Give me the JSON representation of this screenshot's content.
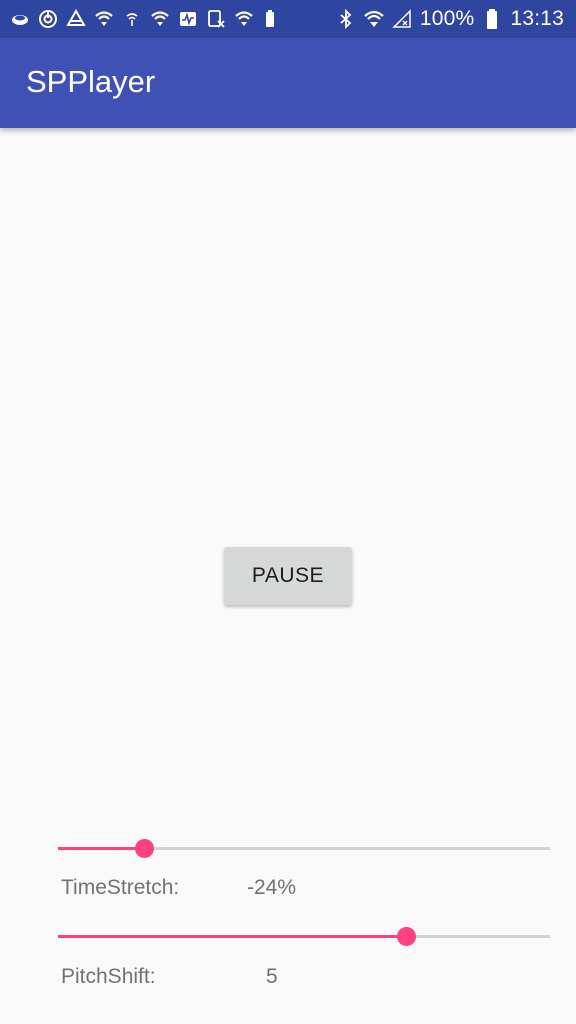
{
  "status_bar": {
    "left_icons": [
      "cloud-icon",
      "power-saving-icon",
      "drive-icon",
      "wifi-icon",
      "wifi-small-icon",
      "wifi-icon",
      "activity-icon",
      "sim-icon",
      "wifi-icon",
      "battery-100-icon"
    ],
    "right_icons": [
      "bluetooth-icon",
      "wifi-icon",
      "signal-icon",
      "battery-icon"
    ],
    "battery_text": "100%",
    "time": "13:13"
  },
  "app_bar": {
    "title": "SPPlayer"
  },
  "controls": {
    "pause_label": "PAUSE"
  },
  "time_stretch": {
    "label": "TimeStretch:",
    "value_text": "-24%",
    "slider_fraction": 0.176
  },
  "pitch_shift": {
    "label": "PitchShift:",
    "value_text": "5",
    "slider_fraction": 0.709
  },
  "colors": {
    "status_bar": "#2f46a0",
    "app_bar": "#3f51b5",
    "accent": "#ff4081",
    "background": "#fafafa"
  }
}
